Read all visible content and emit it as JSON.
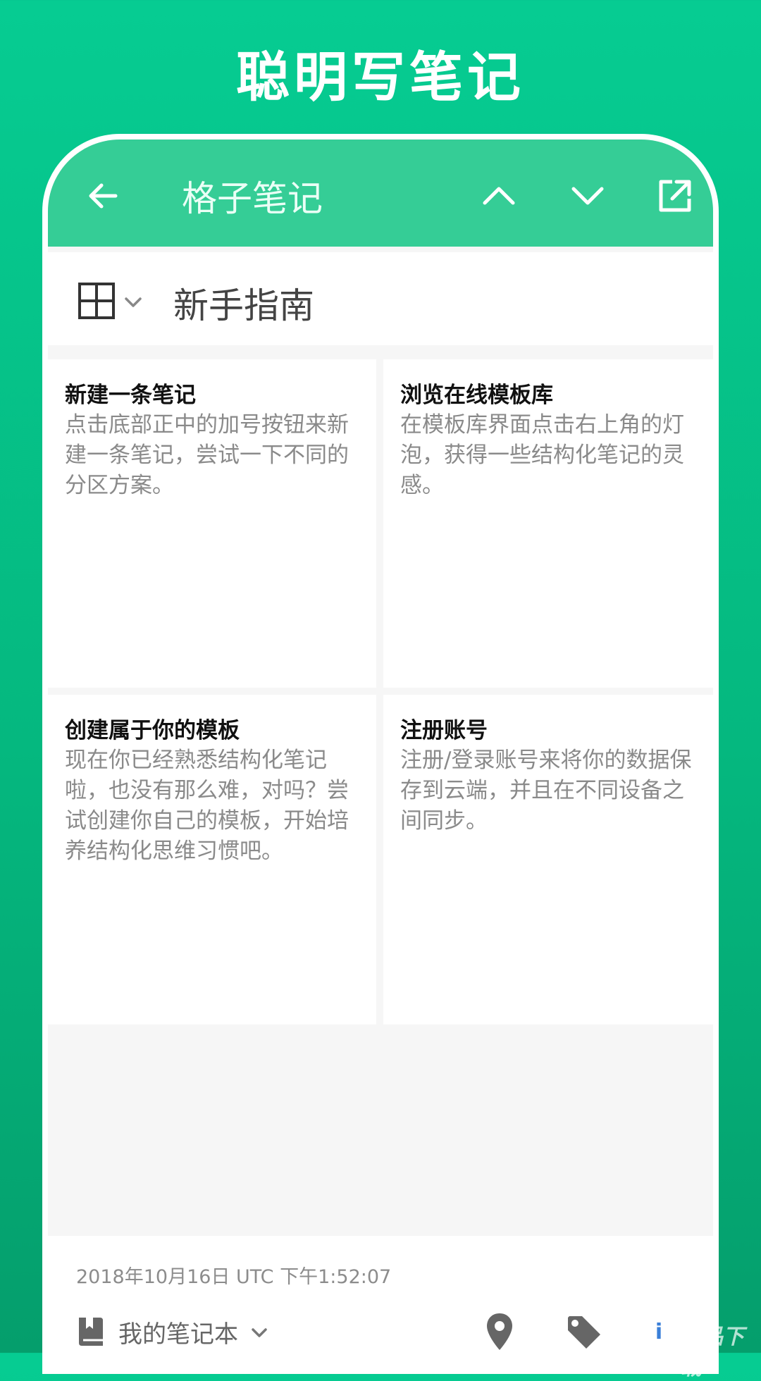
{
  "promo": {
    "title": "聪明写笔记"
  },
  "toolbar": {
    "title": "格子笔记"
  },
  "note": {
    "title": "新手指南"
  },
  "cells": [
    {
      "title": "新建一条笔记",
      "body": "点击底部正中的加号按钮来新建一条笔记，尝试一下不同的分区方案。"
    },
    {
      "title": "浏览在线模板库",
      "body": "在模板库界面点击右上角的灯泡，获得一些结构化笔记的灵感。"
    },
    {
      "title": "创建属于你的模板",
      "body": "现在你已经熟悉结构化笔记啦，也没有那么难，对吗？尝试创建你自己的模板，开始培养结构化思维习惯吧。"
    },
    {
      "title": "注册账号",
      "body": "注册/登录账号来将你的数据保存到云端，并且在不同设备之间同步。"
    }
  ],
  "footer": {
    "timestamp": "2018年10月16日 UTC 下午1:52:07",
    "notebook": "我的笔记本"
  },
  "watermark": {
    "text": "精品下载"
  },
  "colors": {
    "accent": "#35cd96",
    "background": "#06cc92"
  },
  "icons": [
    "back-arrow-icon",
    "chevron-up-icon",
    "chevron-down-icon",
    "share-icon",
    "grid-icon",
    "book-icon",
    "location-pin-icon",
    "tag-icon"
  ]
}
